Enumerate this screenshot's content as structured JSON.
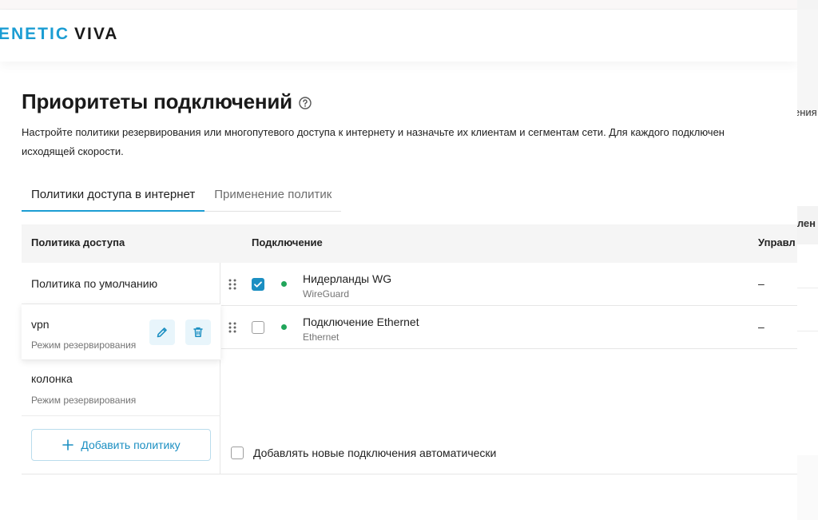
{
  "header": {
    "brand": "ENETIC",
    "product": "VIVA"
  },
  "page": {
    "title": "Приоритеты подключений",
    "description_line1": "Настройте политики резервирования или многопутевого доступа к интернету и назначьте их клиентам и сегментам сети. Для каждого подключен",
    "description_line2": "исходящей скорости."
  },
  "tabs": [
    {
      "label": "Политики доступа в интернет",
      "active": true
    },
    {
      "label": "Применение политик",
      "active": false
    }
  ],
  "table": {
    "col_policy": "Политика доступа",
    "col_connection": "Подключение",
    "col_management": "Управл"
  },
  "policies": [
    {
      "name": "Политика по умолчанию",
      "mode": ""
    },
    {
      "name": "vpn",
      "mode": "Режим резервирования"
    },
    {
      "name": "колонка",
      "mode": "Режим резервирования"
    }
  ],
  "add_policy_label": "Добавить политику",
  "connections": [
    {
      "name": "Нидерланды WG",
      "type": "WireGuard",
      "checked": true,
      "status_color": "#21a55a",
      "management": "–"
    },
    {
      "name": "Подключение Ethernet",
      "type": "Ethernet",
      "checked": false,
      "status_color": "#21a55a",
      "management": "–"
    }
  ],
  "auto_add_label": "Добавлять новые подключения автоматически",
  "right_peek": {
    "text1": "ения",
    "text2": "влен"
  },
  "colors": {
    "accent": "#1b9dd3",
    "accent_dark": "#1b8fc2",
    "status_online": "#21a55a"
  }
}
